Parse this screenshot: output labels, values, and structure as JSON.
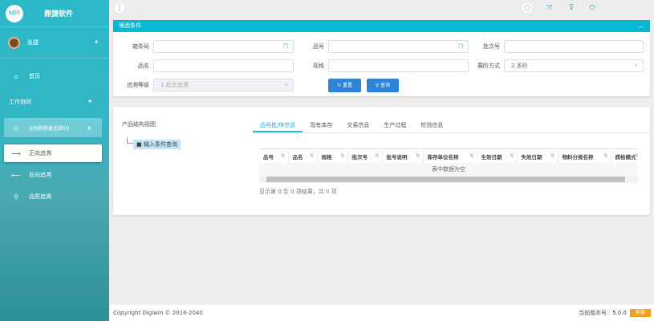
{
  "sidebar": {
    "logo": "MPI",
    "brand": "鼎捷软件",
    "user": "张捷",
    "items": [
      {
        "label": "首页",
        "icon": "home-icon"
      },
      {
        "label": "工作协同"
      },
      {
        "label": "全制程质量追溯5D",
        "icon": "diamond-icon"
      },
      {
        "label": "正向追溯",
        "icon": "arrow-right-icon"
      },
      {
        "label": "反向追溯",
        "icon": "arrow-left-icon"
      },
      {
        "label": "品质追溯",
        "icon": "search-icon"
      }
    ]
  },
  "topbar": {
    "icons": [
      "menu-icon",
      "search-icon",
      "fullscreen-icon",
      "filter-icon",
      "power-icon"
    ]
  },
  "filter": {
    "title": "筛选条件",
    "fields": {
      "barcode": {
        "label": "箱条码",
        "value": ""
      },
      "item_no": {
        "label": "品号",
        "value": ""
      },
      "batch_no": {
        "label": "批次号",
        "value": ""
      },
      "item_name": {
        "label": "品名",
        "value": ""
      },
      "spec": {
        "label": "规格",
        "value": ""
      },
      "level_mode": {
        "label": "展阶方式",
        "value": "2.多阶"
      },
      "trace_level": {
        "label": "追溯等级",
        "value": "1.批次追溯"
      }
    },
    "reset": "重置",
    "query": "查询"
  },
  "result": {
    "tree_title": "产品结构视图",
    "tree_node": "输入条件查询",
    "tabs": [
      "品号批/序信息",
      "现有库存",
      "交易信息",
      "生产过程",
      "检验信息"
    ],
    "columns": [
      "品号",
      "品名",
      "规格",
      "批次号",
      "批号说明",
      "库存单位名称",
      "生效日期",
      "失效日期",
      "物料分类名称",
      "质检模式"
    ],
    "empty": "表中数据为空",
    "summary": "显示第 0 至 0 项结果，共 0 项"
  },
  "footer": {
    "copyright": "Copyright Digiwin © 2016-2040",
    "version_label": "当前版本号：",
    "version": "5.0.0",
    "badge": "新版"
  },
  "colors": {
    "accent": "#03b9d3",
    "button": "#2f83d6",
    "badge": "#f0a020"
  }
}
